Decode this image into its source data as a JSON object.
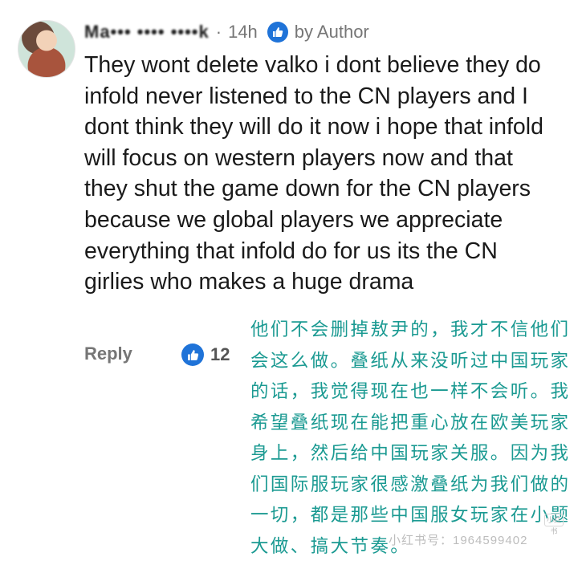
{
  "comment": {
    "username": "Ma••• •••• ••••k",
    "time": "14h",
    "author_badge": "by Author",
    "text": "They wont delete valko i dont believe they do infold never listened to the CN players and I dont think they will do it now i hope that infold will focus on western players now and that they shut the game down for the CN players because we global players we appreciate everything that infold do for us its the CN girlies who makes a huge drama",
    "reply_label": "Reply",
    "like_count": "12"
  },
  "translation": {
    "text": "他们不会删掉敖尹的，我才不信他们会这么做。叠纸从来没听过中国玩家的话，我觉得现在也一样不会听。我希望叠纸现在能把重心放在欧美玩家身上，然后给中国玩家关服。因为我们国际服玩家很感激叠纸为我们做的一切，都是那些中国服女玩家在小题大做、搞大节奏。"
  },
  "watermark": {
    "text": "小红书号：1964599402",
    "logo": "小红书"
  },
  "colors": {
    "accent_blue": "#1f73d8",
    "translation_teal": "#1b9a92",
    "meta_gray": "#767676"
  }
}
